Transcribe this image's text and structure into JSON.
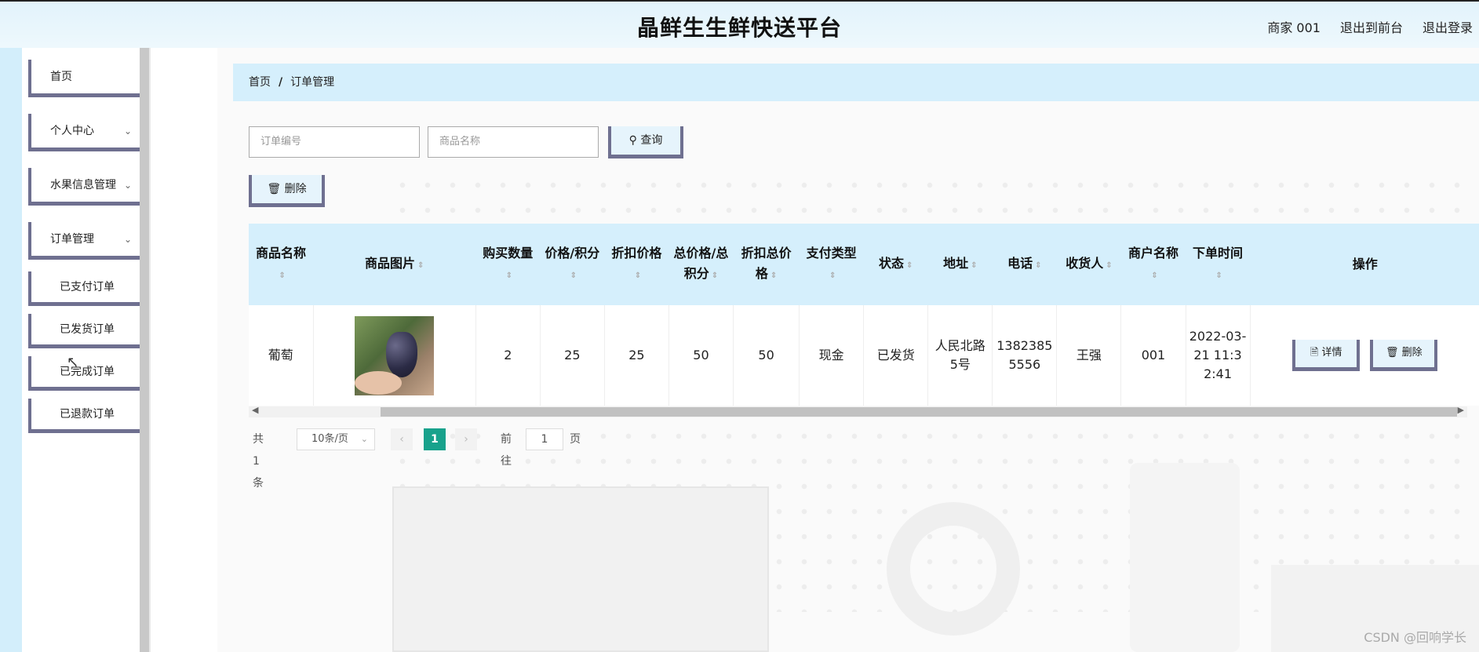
{
  "header": {
    "title": "晶鲜生生鲜快送平台",
    "links": [
      "商家 001",
      "退出到前台",
      "退出登录"
    ]
  },
  "sidebar": {
    "items": [
      {
        "label": "首页",
        "has_children": false
      },
      {
        "label": "个人中心",
        "has_children": true
      },
      {
        "label": "水果信息管理",
        "has_children": true
      },
      {
        "label": "订单管理",
        "has_children": true
      }
    ],
    "order_sub_items": [
      "已支付订单",
      "已发货订单",
      "已完成订单",
      "已退款订单"
    ]
  },
  "breadcrumb": {
    "home": "首页",
    "separator": "/",
    "current": "订单管理"
  },
  "search": {
    "order_no_placeholder": "订单编号",
    "product_name_placeholder": "商品名称",
    "query_label": "查询"
  },
  "toolbar": {
    "delete_label": "删除"
  },
  "table": {
    "columns": [
      "商品名称",
      "商品图片",
      "购买数量",
      "价格/积分",
      "折扣价格",
      "总价格/总积分",
      "折扣总价格",
      "支付类型",
      "状态",
      "地址",
      "电话",
      "收货人",
      "商户名称",
      "下单时间",
      "操作"
    ],
    "rows": [
      {
        "product_name": "葡萄",
        "image_desc": "grape-photo",
        "quantity": "2",
        "price": "25",
        "discount_price": "25",
        "total_price": "50",
        "discount_total": "50",
        "pay_type": "现金",
        "status": "已发货",
        "address": "人民北路5号",
        "phone": "13823855556",
        "receiver": "王强",
        "merchant": "001",
        "order_time": "2022-03-21 11:32:41",
        "detail_label": "详情",
        "delete_label": "删除"
      }
    ]
  },
  "pagination": {
    "total": "共 1 条",
    "page_size": "10条/页",
    "current_page": "1",
    "goto_label": "前往",
    "goto_value": "1",
    "page_unit": "页"
  },
  "watermark": "CSDN @回响学长",
  "colors": {
    "header_bg": "#e2f3fb",
    "accent_light": "#d5effc",
    "button_border": "#6f7090",
    "page_active": "#18a28c"
  }
}
